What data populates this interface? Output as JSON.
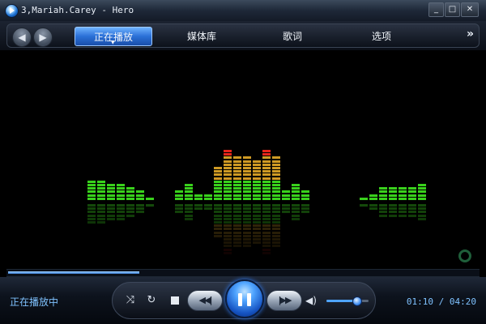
{
  "window": {
    "title": "3,Mariah.Carey - Hero",
    "minimize_glyph": "_",
    "maximize_glyph": "□",
    "close_glyph": "✕"
  },
  "nav": {
    "back_glyph": "◀",
    "forward_glyph": "▶",
    "tabs": [
      {
        "label": "正在播放",
        "active": true
      },
      {
        "label": "媒体库",
        "active": false
      },
      {
        "label": "歌词",
        "active": false
      },
      {
        "label": "选项",
        "active": false
      }
    ],
    "active_caret": "▼",
    "more_glyph": "»"
  },
  "visualizer": {
    "levels": [
      6,
      6,
      5,
      5,
      4,
      3,
      1,
      0,
      0,
      3,
      5,
      2,
      2,
      10,
      15,
      13,
      13,
      12,
      15,
      13,
      3,
      5,
      3,
      0,
      0,
      0,
      0,
      0,
      1,
      2,
      4,
      4,
      4,
      4,
      5
    ],
    "colors": {
      "low": "#39d11c",
      "mid": "#cf9a24",
      "high": "#e7251b"
    }
  },
  "seek": {
    "progress": 0.28
  },
  "controls": {
    "shuffle_glyph": "⤨",
    "repeat_glyph": "↻",
    "prev_glyph": "◀◀|",
    "next_glyph": "|▶▶",
    "volume_glyph": "◀)",
    "volume_level": 0.72
  },
  "status": {
    "text": "正在播放中",
    "time": "01:10 / 04:20"
  }
}
